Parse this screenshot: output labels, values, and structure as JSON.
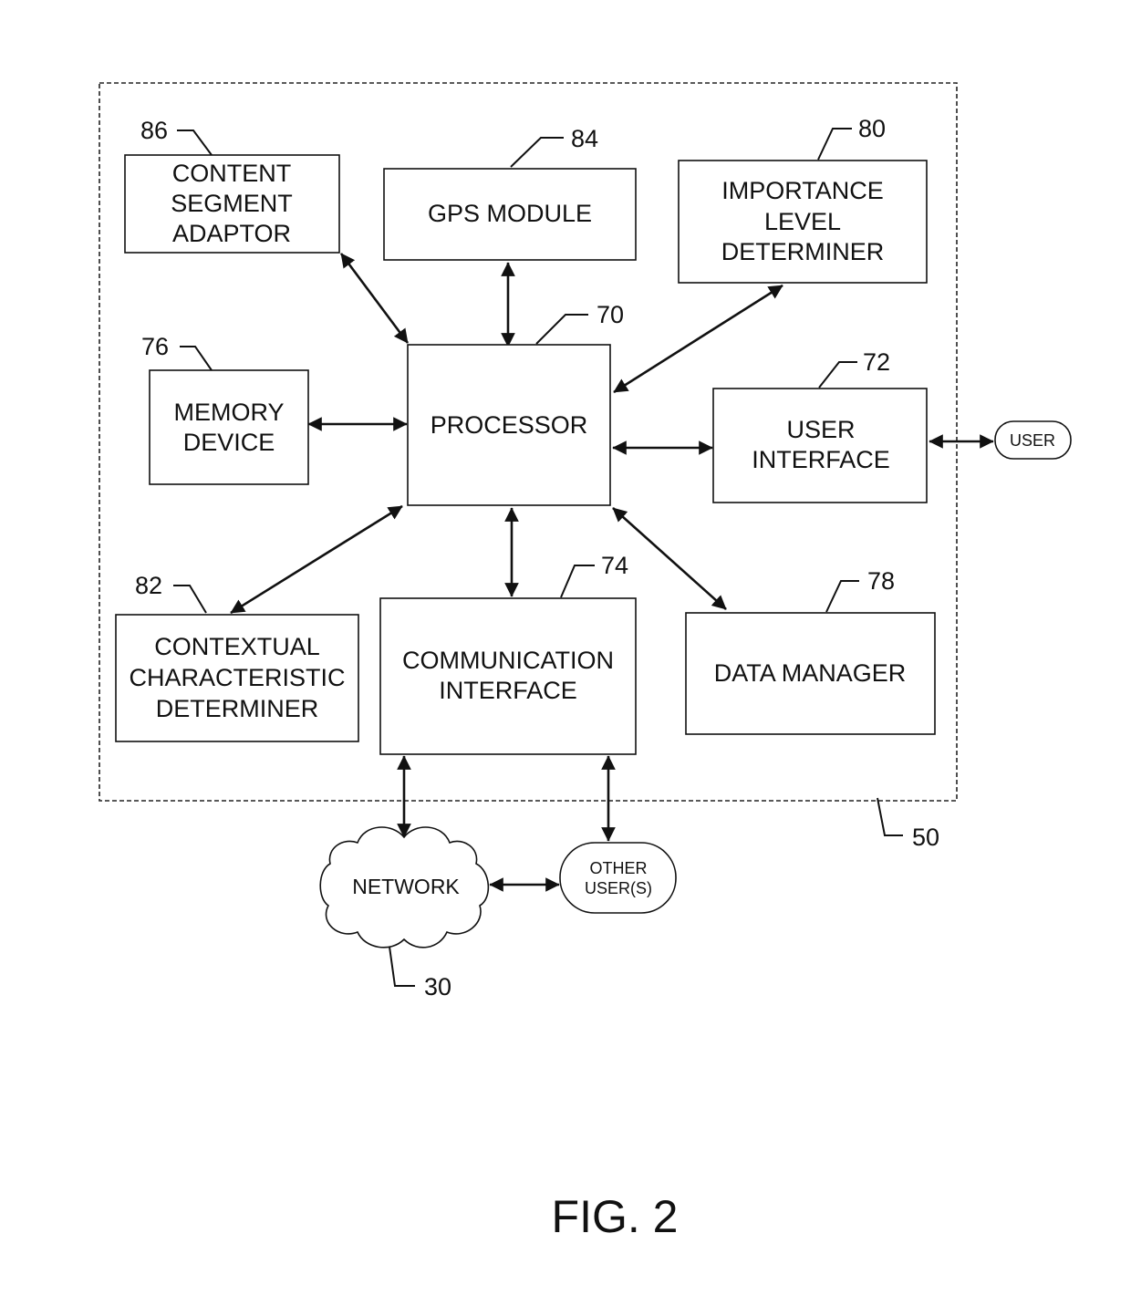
{
  "figure": {
    "caption": "FIG. 2",
    "apparatus_ref": "50"
  },
  "blocks": {
    "content_segment_adaptor": {
      "ref": "86",
      "lines": [
        "CONTENT",
        "SEGMENT",
        "ADAPTOR"
      ]
    },
    "gps_module": {
      "ref": "84",
      "lines": [
        "GPS MODULE"
      ]
    },
    "importance_level_determiner": {
      "ref": "80",
      "lines": [
        "IMPORTANCE",
        "LEVEL",
        "DETERMINER"
      ]
    },
    "processor": {
      "ref": "70",
      "lines": [
        "PROCESSOR"
      ]
    },
    "memory_device": {
      "ref": "76",
      "lines": [
        "MEMORY",
        "DEVICE"
      ]
    },
    "user_interface": {
      "ref": "72",
      "lines": [
        "USER",
        "INTERFACE"
      ]
    },
    "contextual_characteristic_determiner": {
      "ref": "82",
      "lines": [
        "CONTEXTUAL",
        "CHARACTERISTIC",
        "DETERMINER"
      ]
    },
    "communication_interface": {
      "ref": "74",
      "lines": [
        "COMMUNICATION",
        "INTERFACE"
      ]
    },
    "data_manager": {
      "ref": "78",
      "lines": [
        "DATA MANAGER"
      ]
    }
  },
  "external": {
    "user": {
      "label": "USER"
    },
    "other_users": {
      "lines": [
        "OTHER",
        "USER(S)"
      ]
    },
    "network": {
      "ref": "30",
      "label": "NETWORK"
    }
  },
  "connections": [
    {
      "from": "content_segment_adaptor",
      "to": "processor",
      "type": "bidirectional"
    },
    {
      "from": "gps_module",
      "to": "processor",
      "type": "bidirectional"
    },
    {
      "from": "importance_level_determiner",
      "to": "processor",
      "type": "bidirectional"
    },
    {
      "from": "memory_device",
      "to": "processor",
      "type": "bidirectional"
    },
    {
      "from": "processor",
      "to": "user_interface",
      "type": "bidirectional"
    },
    {
      "from": "user_interface",
      "to": "user",
      "type": "bidirectional"
    },
    {
      "from": "processor",
      "to": "contextual_characteristic_determiner",
      "type": "bidirectional"
    },
    {
      "from": "processor",
      "to": "communication_interface",
      "type": "bidirectional"
    },
    {
      "from": "processor",
      "to": "data_manager",
      "type": "bidirectional"
    },
    {
      "from": "communication_interface",
      "to": "network",
      "type": "bidirectional"
    },
    {
      "from": "communication_interface",
      "to": "other_users",
      "type": "bidirectional"
    },
    {
      "from": "network",
      "to": "other_users",
      "type": "bidirectional"
    }
  ]
}
